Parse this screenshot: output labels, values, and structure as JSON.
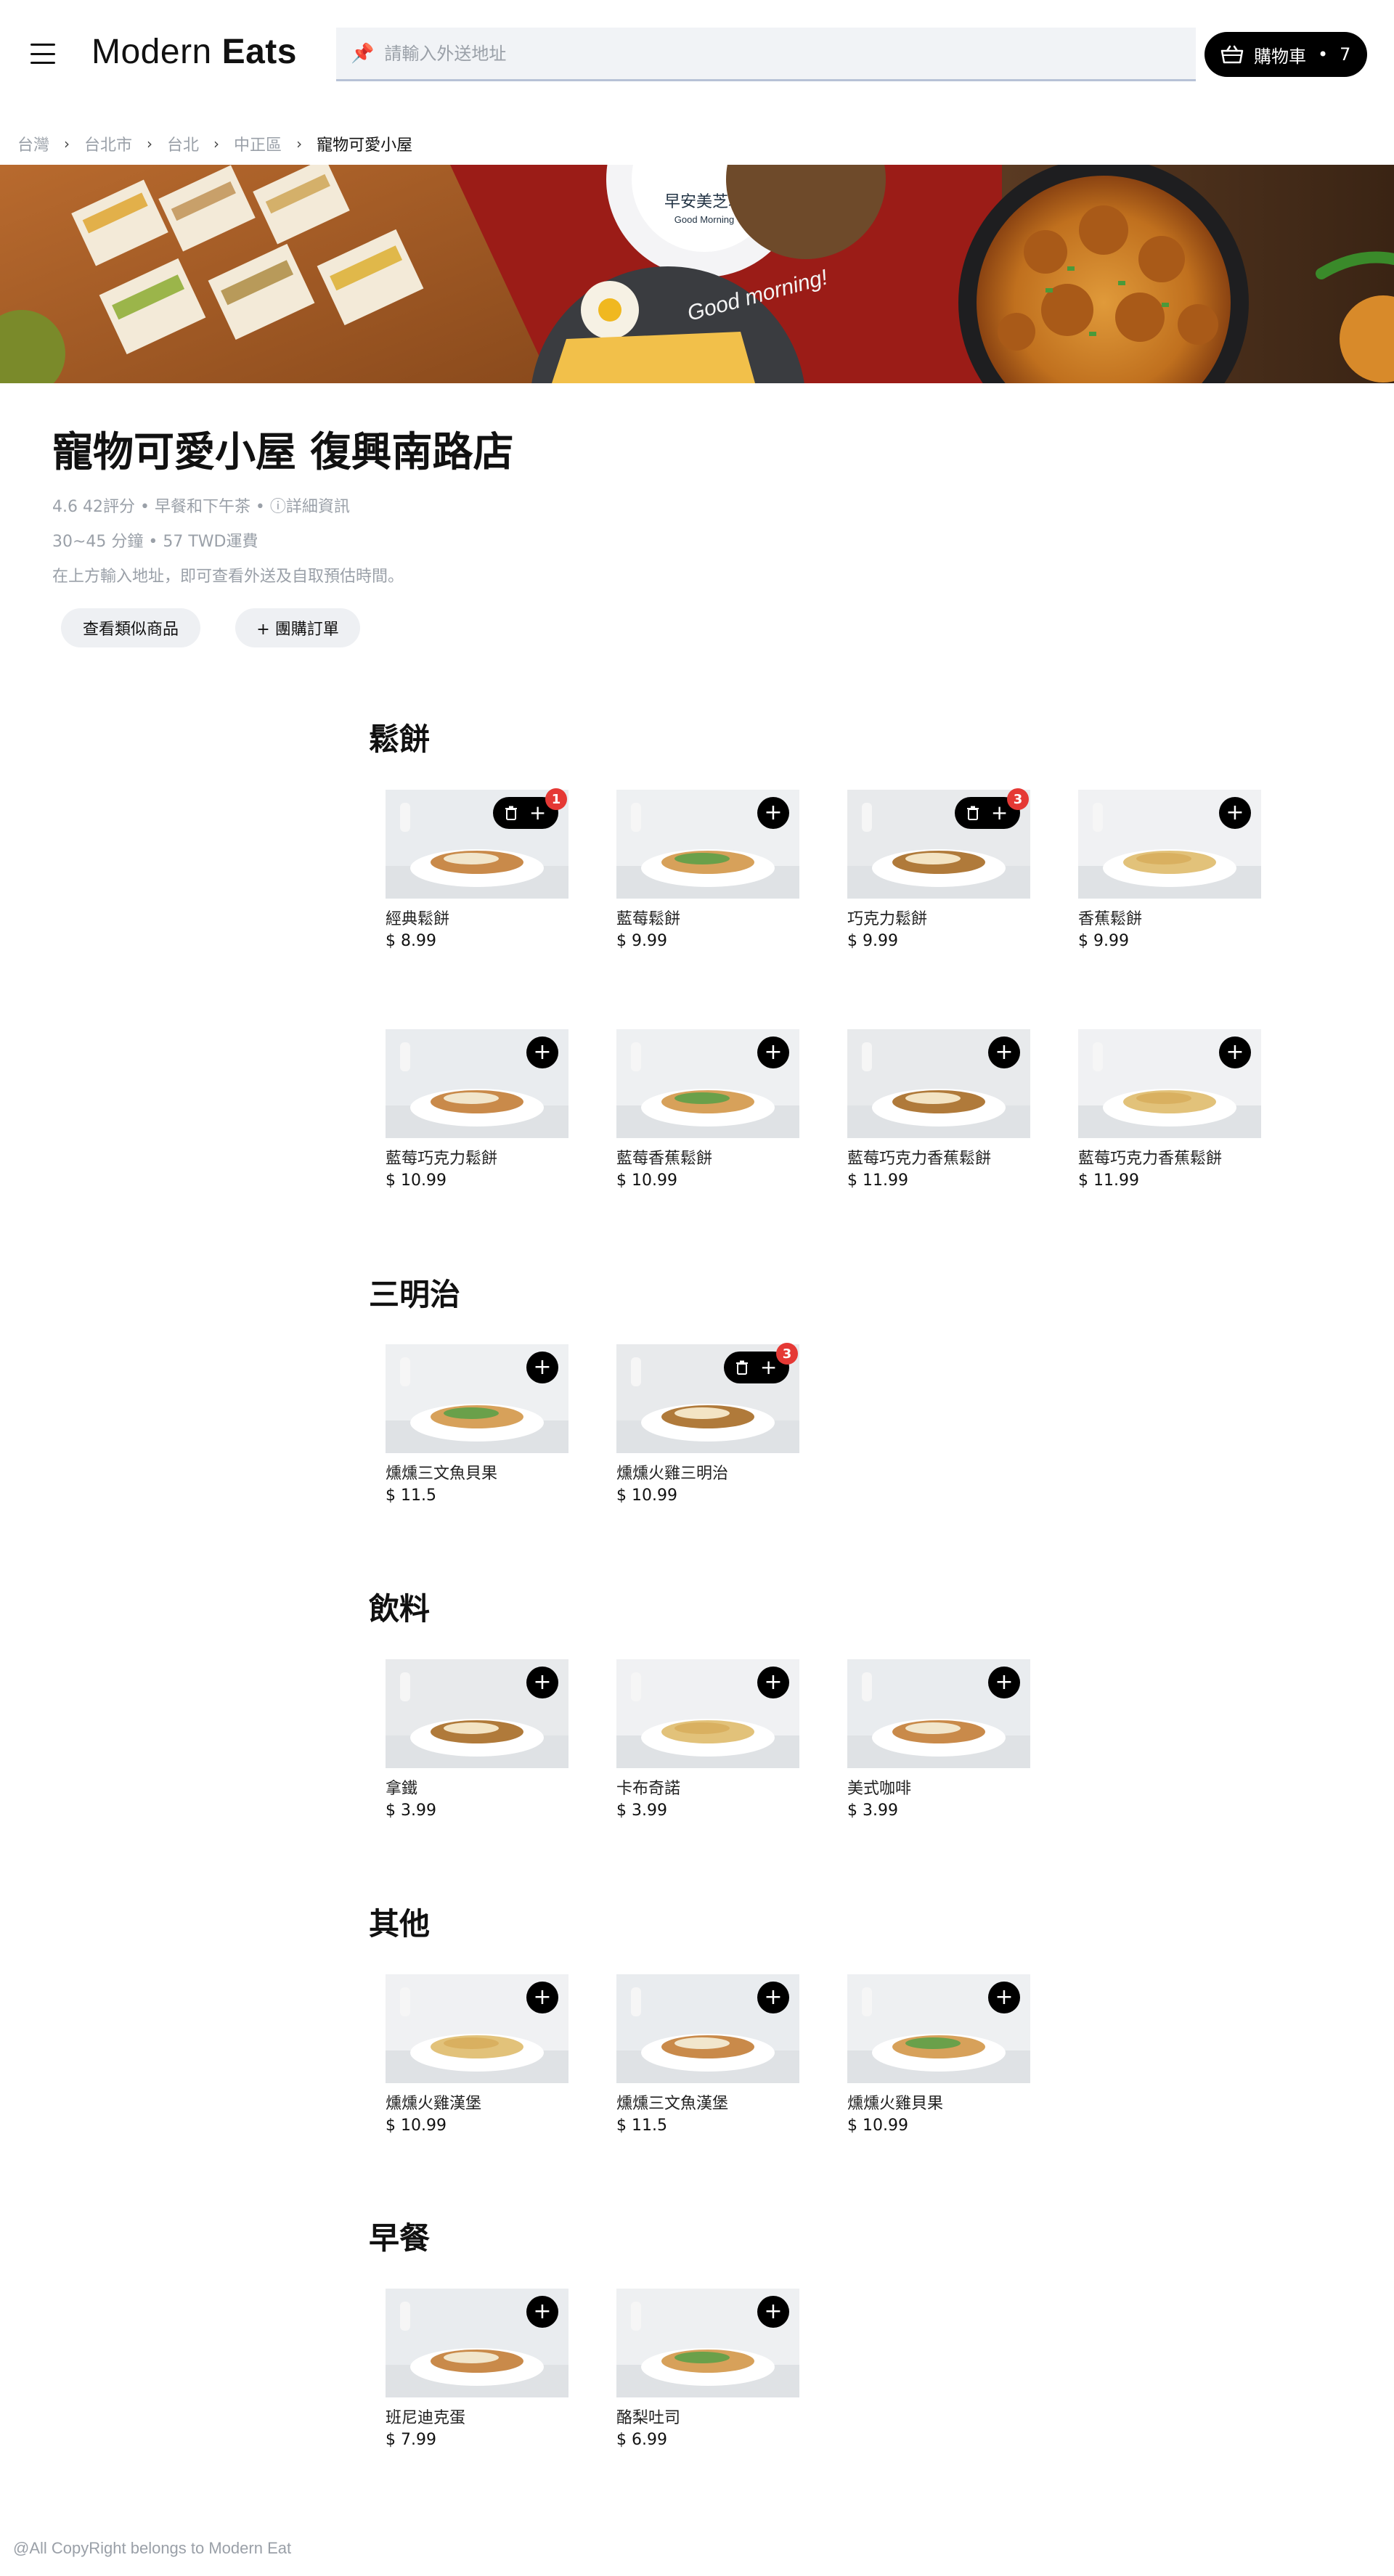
{
  "header": {
    "logo_light": "Modern ",
    "logo_bold": "Eats",
    "search_placeholder": "請輸入外送地址",
    "cart_label": "購物車",
    "cart_separator": "•",
    "cart_count": "7"
  },
  "breadcrumb": [
    "台灣",
    "台北市",
    "台北",
    "中正區",
    "寵物可愛小屋"
  ],
  "store": {
    "title": "寵物可愛小屋 復興南路店",
    "meta_line1": "4.6 42評分 • 早餐和下午茶 • ⓘ詳細資訊",
    "meta_line2": "30~45 分鐘 • 57 TWD運費",
    "meta_line3": "在上方輸入地址，即可查看外送及自取預估時間。",
    "chip_similar": "查看類似商品",
    "chip_group": "+ 團購訂單"
  },
  "sections": [
    {
      "title": "鬆餅",
      "items": [
        {
          "name": "經典鬆餅",
          "price": "$ 8.99",
          "qty": "1"
        },
        {
          "name": "藍莓鬆餅",
          "price": "$ 9.99"
        },
        {
          "name": "巧克力鬆餅",
          "price": "$ 9.99",
          "qty": "3"
        },
        {
          "name": "香蕉鬆餅",
          "price": "$ 9.99"
        },
        {
          "name": "藍莓巧克力鬆餅",
          "price": "$ 10.99"
        },
        {
          "name": "藍莓香蕉鬆餅",
          "price": "$ 10.99"
        },
        {
          "name": "藍莓巧克力香蕉鬆餅",
          "price": "$ 11.99"
        },
        {
          "name": "藍莓巧克力香蕉鬆餅",
          "price": "$ 11.99"
        }
      ]
    },
    {
      "title": "三明治",
      "items": [
        {
          "name": "燻燻三文魚貝果",
          "price": "$ 11.5"
        },
        {
          "name": "燻燻火雞三明治",
          "price": "$ 10.99",
          "qty": "3"
        }
      ]
    },
    {
      "title": "飲料",
      "items": [
        {
          "name": "拿鐵",
          "price": "$ 3.99"
        },
        {
          "name": "卡布奇諾",
          "price": "$ 3.99"
        },
        {
          "name": "美式咖啡",
          "price": "$ 3.99"
        }
      ]
    },
    {
      "title": "其他",
      "items": [
        {
          "name": "燻燻火雞漢堡",
          "price": "$ 10.99"
        },
        {
          "name": "燻燻三文魚漢堡",
          "price": "$ 11.5"
        },
        {
          "name": "燻燻火雞貝果",
          "price": "$ 10.99"
        }
      ]
    },
    {
      "title": "早餐",
      "items": [
        {
          "name": "班尼迪克蛋",
          "price": "$ 7.99"
        },
        {
          "name": "酪梨吐司",
          "price": "$ 6.99"
        }
      ]
    }
  ],
  "banner": {
    "plate_text_1": "早安美芝城",
    "plate_text_2": "Good Morning",
    "plate_text_3": "Good morning!"
  },
  "footer": {
    "copyright": "@All CopyRight belongs to Modern Eat"
  },
  "colors": {
    "accent_black": "#000000",
    "badge_red": "#e53935",
    "muted_text": "#9aa0a8"
  }
}
